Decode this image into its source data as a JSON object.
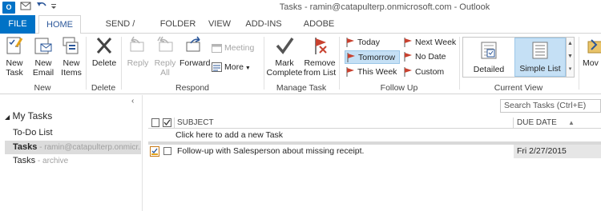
{
  "window": {
    "title": "Tasks - ramin@catapulterp.onmicrosoft.com - Outlook",
    "app_icon": "O"
  },
  "tabs": [
    {
      "label": "FILE"
    },
    {
      "label": "HOME"
    },
    {
      "label": "SEND / RECEIVE"
    },
    {
      "label": "FOLDER"
    },
    {
      "label": "VIEW"
    },
    {
      "label": "ADD-INS"
    },
    {
      "label": "ADOBE PDF"
    }
  ],
  "ribbon": {
    "new": {
      "label": "New",
      "new_task": "New\nTask",
      "new_email": "New\nEmail",
      "new_items": "New\nItems"
    },
    "delete": {
      "label": "Delete",
      "delete": "Delete"
    },
    "respond": {
      "label": "Respond",
      "reply": "Reply",
      "reply_all": "Reply\nAll",
      "forward": "Forward",
      "meeting": "Meeting",
      "more": "More"
    },
    "manage": {
      "label": "Manage Task",
      "mark_complete": "Mark\nComplete",
      "remove_from_list": "Remove\nfrom List"
    },
    "follow_up": {
      "label": "Follow Up",
      "today": "Today",
      "tomorrow": "Tomorrow",
      "this_week": "This Week",
      "next_week": "Next Week",
      "no_date": "No Date",
      "custom": "Custom"
    },
    "current_view": {
      "label": "Current View",
      "detailed": "Detailed",
      "simple_list": "Simple List"
    },
    "move": {
      "label": "Mov"
    }
  },
  "nav": {
    "header": "My Tasks",
    "items": [
      {
        "label": "To-Do List",
        "sub": ""
      },
      {
        "label": "Tasks",
        "sub": " - ramin@catapulterp.onmicr..."
      },
      {
        "label": "Tasks",
        "sub": " - archive"
      }
    ]
  },
  "tasklist": {
    "search_placeholder": "Search Tasks (Ctrl+E)",
    "col_subject": "SUBJECT",
    "col_due": "DUE DATE",
    "add_new": "Click here to add a new Task",
    "rows": [
      {
        "subject": "Follow-up with Salesperson about missing receipt.",
        "due": "Fri 2/27/2015"
      }
    ]
  },
  "colors": {
    "accent": "#0072c6",
    "flag": "#c8412f",
    "selected": "#c5e0f5"
  }
}
